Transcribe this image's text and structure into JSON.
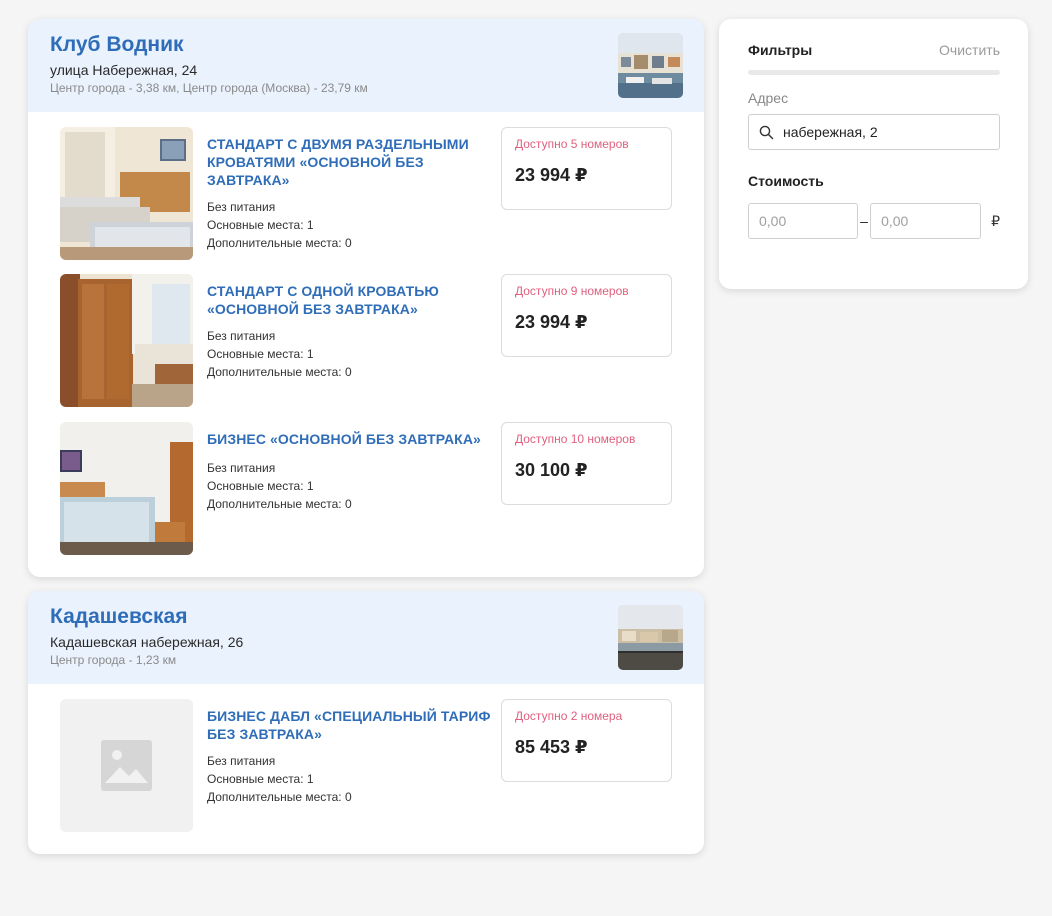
{
  "hotels": [
    {
      "name": "Клуб Водник",
      "address": "улица Набережная, 24",
      "distance": "Центр города - 3,38 км, Центр города (Москва) - 23,79 км",
      "rooms": [
        {
          "title": "СТАНДАРТ С ДВУМЯ РАЗДЕЛЬНЫМИ КРОВАТЯМИ «ОСНОВНОЙ БЕЗ ЗАВТРАКА»",
          "meal": "Без питания",
          "main_places": "Основные места: 1",
          "extra_places": "Дополнительные места: 0",
          "available": "Доступно 5 номеров",
          "price": "23 994 ₽"
        },
        {
          "title": "СТАНДАРТ С ОДНОЙ КРОВАТЬЮ «ОСНОВНОЙ БЕЗ ЗАВТРАКА»",
          "meal": "Без питания",
          "main_places": "Основные места: 1",
          "extra_places": "Дополнительные места: 0",
          "available": "Доступно 9 номеров",
          "price": "23 994 ₽"
        },
        {
          "title": "БИЗНЕС «ОСНОВНОЙ БЕЗ ЗАВТРАКА»",
          "meal": "Без питания",
          "main_places": "Основные места: 1",
          "extra_places": "Дополнительные места: 0",
          "available": "Доступно 10 номеров",
          "price": "30 100 ₽"
        }
      ]
    },
    {
      "name": "Кадашевская",
      "address": "Кадашевская набережная, 26",
      "distance": "Центр города - 1,23 км",
      "rooms": [
        {
          "title": "БИЗНЕС ДАБЛ «СПЕЦИАЛЬНЫЙ ТАРИФ БЕЗ ЗАВТРАКА»",
          "meal": "Без питания",
          "main_places": "Основные места: 1",
          "extra_places": "Дополнительные места: 0",
          "available": "Доступно 2 номера",
          "price": "85 453 ₽"
        }
      ]
    }
  ],
  "filters": {
    "title": "Фильтры",
    "clear": "Очистить",
    "address_label": "Адрес",
    "address_value": "набережная, 2",
    "cost_label": "Стоимость",
    "cost_from_placeholder": "0,00",
    "cost_to_placeholder": "0,00",
    "dash": "–",
    "currency": "₽"
  },
  "icons": {
    "search": "search-icon",
    "placeholder": "image-placeholder-icon"
  },
  "colors": {
    "accent_blue": "#2f6db8",
    "header_bg": "#eaf2fd",
    "availability": "#e0607e"
  }
}
